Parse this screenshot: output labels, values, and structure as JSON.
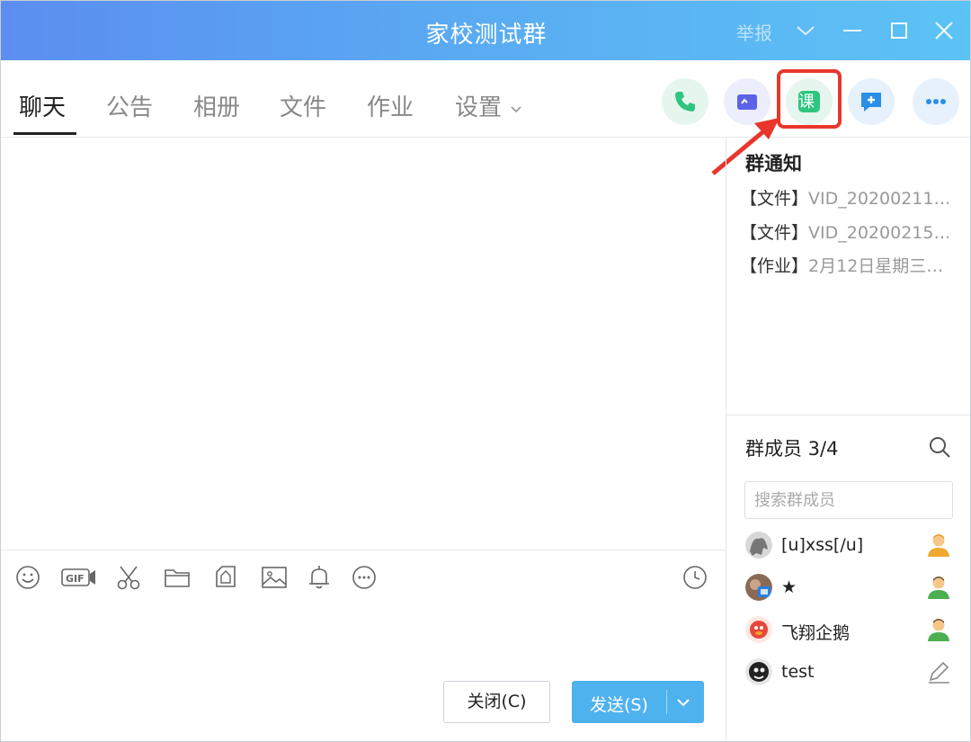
{
  "window": {
    "title": "家校测试群",
    "report_label": "举报"
  },
  "tabs": [
    {
      "label": "聊天",
      "active": true
    },
    {
      "label": "公告"
    },
    {
      "label": "相册"
    },
    {
      "label": "文件"
    },
    {
      "label": "作业"
    },
    {
      "label": "设置"
    }
  ],
  "header_actions": [
    {
      "name": "voice-call",
      "icon": "phone-icon",
      "color": "#2fc57e"
    },
    {
      "name": "video-call",
      "icon": "video-icon",
      "color": "#5b63e8"
    },
    {
      "name": "class",
      "icon": "class-icon",
      "label": "课",
      "color": "#2fc57e"
    },
    {
      "name": "new-topic",
      "icon": "chat-plus-icon",
      "color": "#2b8fe6"
    },
    {
      "name": "more",
      "icon": "more-icon",
      "color": "#2b8fe6"
    }
  ],
  "notices": {
    "title": "群通知",
    "items": [
      {
        "tag": "【文件】",
        "text": "VID_20200211…"
      },
      {
        "tag": "【文件】",
        "text": "VID_20200215…"
      },
      {
        "tag": "【作业】",
        "text": "2月12日星期三…"
      }
    ]
  },
  "members": {
    "title": "群成员 3/4",
    "search_placeholder": "搜索群成员",
    "list": [
      {
        "name": "[u]xss[/u]",
        "role": "member-icon",
        "role_color": "#f0a830"
      },
      {
        "name": "★",
        "role": "member-icon",
        "role_color": "#4caf50"
      },
      {
        "name": "飞翔企鹅",
        "role": "member-icon",
        "role_color": "#4caf50"
      },
      {
        "name": "test",
        "role": "edit-icon"
      }
    ]
  },
  "toolbar_icons": [
    "emoji-icon",
    "gif-icon",
    "scissors-icon",
    "folder-icon",
    "screenshot-icon",
    "image-icon",
    "bell-icon",
    "more-circle-icon",
    "history-icon"
  ],
  "buttons": {
    "close": "关闭(C)",
    "send": "发送(S)"
  }
}
